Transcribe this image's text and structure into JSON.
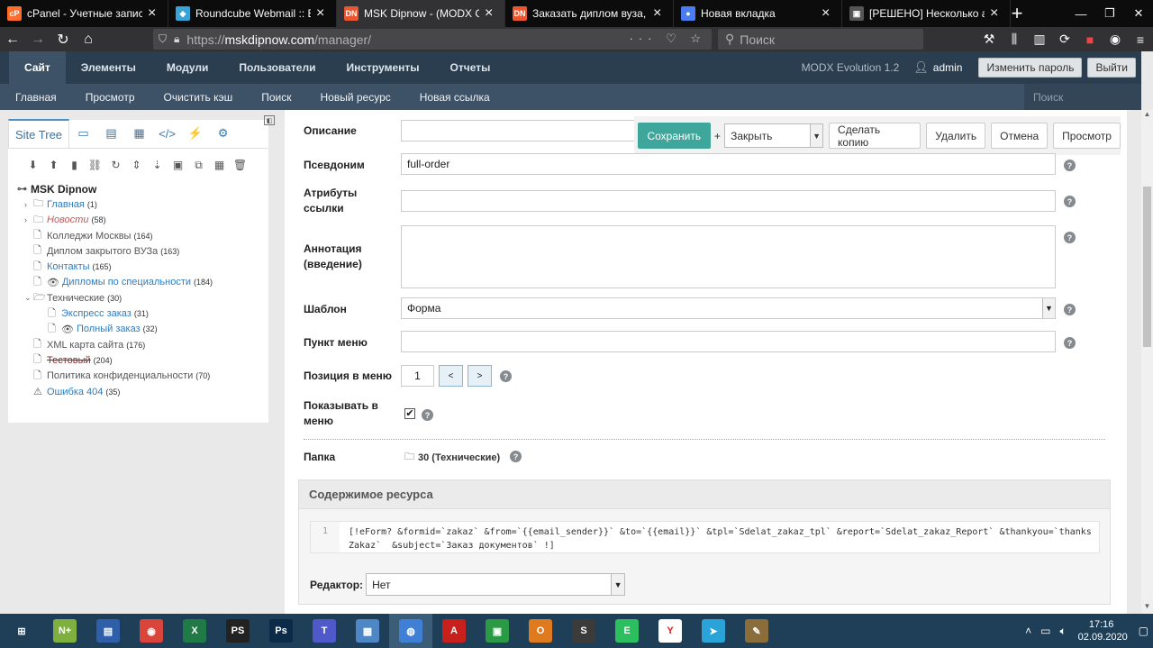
{
  "browser": {
    "tabs": [
      {
        "title": "cPanel - Учетные записи",
        "favicon": "cP",
        "color": "#ff6c2c",
        "active": false
      },
      {
        "title": "Roundcube Webmail :: Вхо",
        "favicon": "◆",
        "color": "#37a3d6",
        "active": false
      },
      {
        "title": "MSK Dipnow - (MODX CM",
        "favicon": "DN",
        "color": "#e9562f",
        "active": true
      },
      {
        "title": "Заказать диплом вуза, ко",
        "favicon": "DN",
        "color": "#e9562f",
        "active": false
      },
      {
        "title": "Новая вкладка",
        "favicon": "●",
        "color": "#4a7cf2",
        "active": false
      },
      {
        "title": "[РЕШЕНО] Несколько ая",
        "favicon": "▣",
        "color": "#555555",
        "active": false
      }
    ],
    "url_scheme": "https://",
    "url_host": "mskdipnow.com",
    "url_path": "/manager/",
    "search_placeholder": "Поиск"
  },
  "modx": {
    "menu": [
      "Сайт",
      "Элементы",
      "Модули",
      "Пользователи",
      "Инструменты",
      "Отчеты"
    ],
    "active_menu": "Сайт",
    "version": "MODX Evolution 1.2",
    "user": "admin",
    "change_password": "Изменить пароль",
    "logout": "Выйти",
    "submenu": [
      "Главная",
      "Просмотр",
      "Очистить кэш",
      "Поиск",
      "Новый ресурс",
      "Новая ссылка"
    ],
    "search_placeholder": "Поиск"
  },
  "tree": {
    "tab_label": "Site Tree",
    "root": "MSK Dipnow",
    "nodes": [
      {
        "label": "Главная",
        "count": "(1)",
        "type": "folder",
        "style": "link",
        "indent": 0
      },
      {
        "label": "Новости",
        "count": "(58)",
        "type": "folder",
        "style": "italic",
        "indent": 0
      },
      {
        "label": "Колледжи Москвы",
        "count": "(164)",
        "type": "page",
        "style": "grey",
        "indent": 0
      },
      {
        "label": "Диплом закрытого ВУЗа",
        "count": "(163)",
        "type": "page",
        "style": "grey",
        "indent": 0
      },
      {
        "label": "Контакты",
        "count": "(165)",
        "type": "page",
        "style": "link",
        "indent": 0
      },
      {
        "label": "Дипломы по специальности",
        "count": "(184)",
        "type": "page-eye",
        "style": "link",
        "indent": 0
      },
      {
        "label": "Технические",
        "count": "(30)",
        "type": "folder-open",
        "style": "grey",
        "indent": 0
      },
      {
        "label": "Экспресс заказ",
        "count": "(31)",
        "type": "page",
        "style": "link",
        "indent": 1
      },
      {
        "label": "Полный заказ",
        "count": "(32)",
        "type": "page-eye",
        "style": "link",
        "indent": 1
      },
      {
        "label": "XML карта сайта",
        "count": "(176)",
        "type": "page",
        "style": "grey",
        "indent": 0
      },
      {
        "label": "Тестовый",
        "count": "(204)",
        "type": "page",
        "style": "strike",
        "indent": 0
      },
      {
        "label": "Политика конфиденциальности",
        "count": "(70)",
        "type": "page",
        "style": "grey",
        "indent": 0
      },
      {
        "label": "Ошибка 404",
        "count": "(35)",
        "type": "warn",
        "style": "link",
        "indent": 0
      }
    ]
  },
  "actions": {
    "save": "Сохранить",
    "plus": "+",
    "close_select": "Закрыть",
    "copy": "Сделать копию",
    "delete": "Удалить",
    "cancel": "Отмена",
    "preview": "Просмотр"
  },
  "form": {
    "description_label": "Описание",
    "description_value": "",
    "alias_label": "Псевдоним",
    "alias_value": "full-order",
    "link_attr_label": "Атрибуты ссылки",
    "link_attr_value": "",
    "annotation_label": "Аннотация (введение)",
    "annotation_value": "",
    "template_label": "Шаблон",
    "template_value": "Форма",
    "menu_title_label": "Пункт меню",
    "menu_title_value": "",
    "menu_index_label": "Позиция в меню",
    "menu_index_value": "1",
    "prev": "<",
    "next": ">",
    "show_in_menu_label": "Показывать в меню",
    "show_in_menu_checked": true,
    "parent_label": "Папка",
    "parent_value": "30 (Технические)"
  },
  "content": {
    "header": "Содержимое ресурса",
    "line_number": "1",
    "code": "[!eForm? &formid=`zakaz` &from=`{{email_sender}}` &to=`{{email}}` &tpl=`Sdelat_zakaz_tpl` &report=`Sdelat_zakaz_Report` &thankyou=`thanksZakaz`  &subject=`Заказ документов` !]",
    "editor_label": "Редактор:",
    "editor_value": "Нет"
  },
  "taskbar": {
    "apps": [
      {
        "icon": "windows-start-icon",
        "label": "⊞",
        "color": "#1e3f57"
      },
      {
        "icon": "notepad-plus-icon",
        "label": "N+",
        "color": "#7fb03f"
      },
      {
        "icon": "floppy-save-icon",
        "label": "▤",
        "color": "#2e5fa8"
      },
      {
        "icon": "chrome-icon",
        "label": "◉",
        "color": "#d9453a"
      },
      {
        "icon": "excel-icon",
        "label": "X",
        "color": "#1f7a45"
      },
      {
        "icon": "phpstorm-icon",
        "label": "PS",
        "color": "#222222"
      },
      {
        "icon": "photoshop-icon",
        "label": "Ps",
        "color": "#0b2b48"
      },
      {
        "icon": "teams-icon",
        "label": "T",
        "color": "#5059c9"
      },
      {
        "icon": "control-panel-icon",
        "label": "▦",
        "color": "#4f86c6"
      },
      {
        "icon": "firefox-icon",
        "label": "◍",
        "color": "#3f7fd6"
      },
      {
        "icon": "acrobat-icon",
        "label": "A",
        "color": "#c8201c"
      },
      {
        "icon": "store-icon",
        "label": "▣",
        "color": "#2a9a44"
      },
      {
        "icon": "office-icon",
        "label": "O",
        "color": "#e07a1f"
      },
      {
        "icon": "sublime-icon",
        "label": "S",
        "color": "#3b3b3b"
      },
      {
        "icon": "evernote-icon",
        "label": "E",
        "color": "#2dbe60"
      },
      {
        "icon": "yandex-icon",
        "label": "Y",
        "color": "#ffffff"
      },
      {
        "icon": "telegram-icon",
        "label": "➤",
        "color": "#2aa3d8"
      },
      {
        "icon": "paint-icon",
        "label": "✎",
        "color": "#8a6d3b"
      }
    ],
    "time": "17:16",
    "date": "02.09.2020"
  }
}
